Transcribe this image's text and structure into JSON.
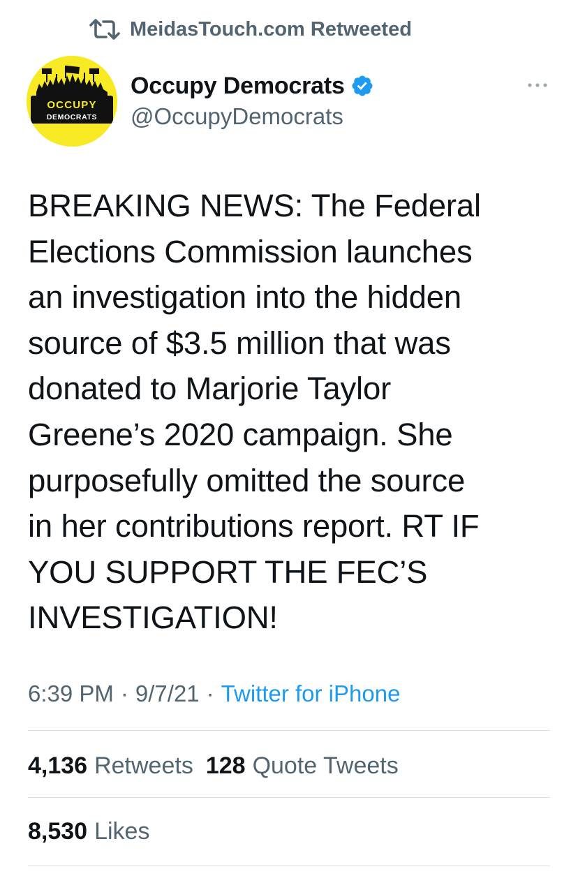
{
  "social_context": {
    "icon": "retweet-icon",
    "text": "MeidasTouch.com Retweeted"
  },
  "author": {
    "avatar_text_line1": "OCCUPY",
    "avatar_text_line2": "DEMOCRATS",
    "display_name": "Occupy Democrats",
    "handle": "@OccupyDemocrats",
    "verified": true
  },
  "tweet": {
    "text": "BREAKING NEWS: The Federal\nElections Commission launches\nan investigation into the hidden\nsource of $3.5 million that was\ndonated to Marjorie Taylor\nGreene’s 2020 campaign. She\npurposefully omitted the source\nin her contributions report. RT IF\nYOU SUPPORT THE FEC’S\nINVESTIGATION!",
    "time": "6:39 PM",
    "date": "9/7/21",
    "separator": "·",
    "source": "Twitter for iPhone"
  },
  "stats": {
    "retweets_count": "4,136",
    "retweets_label": "Retweets",
    "quotes_count": "128",
    "quotes_label": "Quote Tweets",
    "likes_count": "8,530",
    "likes_label": "Likes"
  },
  "colors": {
    "accent": "#1d9bf0",
    "secondary_text": "#536471",
    "avatar_bg": "#f7ea24"
  }
}
